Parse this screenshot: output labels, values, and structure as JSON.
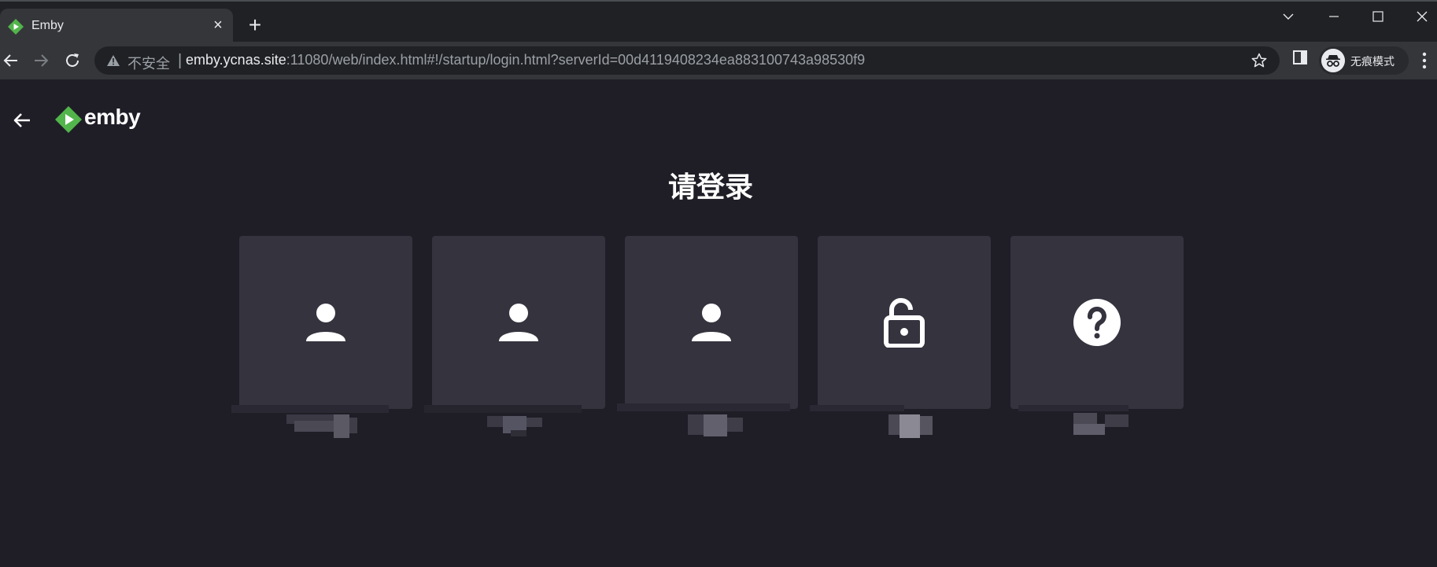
{
  "browser": {
    "tab_title": "Emby",
    "new_tab": "+",
    "tab_close": "×",
    "address": {
      "security_label": "不安全",
      "separator": "|",
      "host": "emby.ycnas.site",
      "rest": ":11080/web/index.html#!/startup/login.html?serverId=00d4119408234ea883100743a98530f9"
    },
    "profile_label": "无痕模式",
    "colors": {
      "chrome_bg": "#202124",
      "toolbar_bg": "#35363a",
      "omnibox_bg": "#202124"
    }
  },
  "app": {
    "logo_text": "emby",
    "heading": "请登录",
    "users": [
      {
        "icon": "person-icon",
        "name": ""
      },
      {
        "icon": "person-icon",
        "name": ""
      },
      {
        "icon": "person-icon",
        "name": ""
      },
      {
        "icon": "lock-open-icon",
        "name": ""
      },
      {
        "icon": "help-icon",
        "name": ""
      }
    ],
    "colors": {
      "page_bg": "#1f1e27",
      "card_bg": "#35333e",
      "brand_green": "#52b54b"
    }
  }
}
